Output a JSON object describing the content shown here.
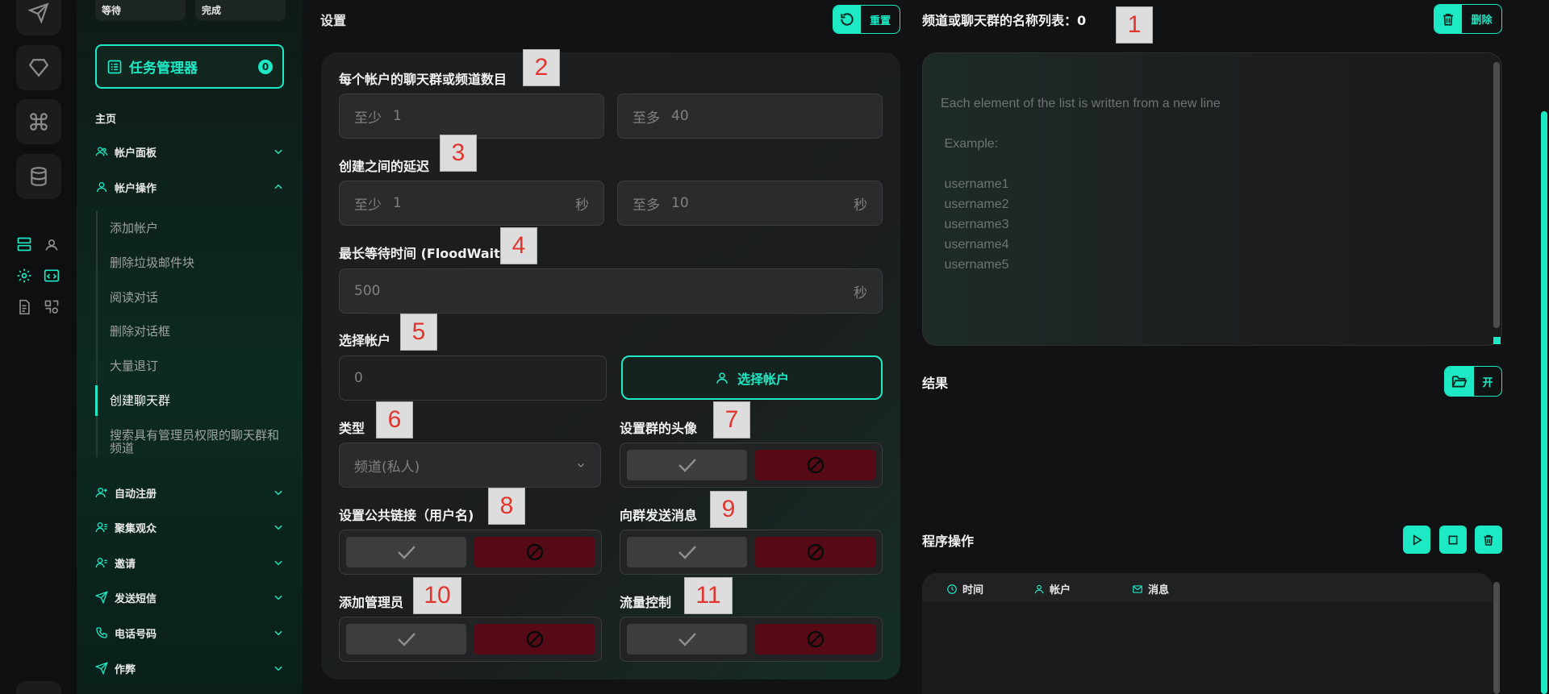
{
  "sidebar": {
    "status_tabs": [
      "等待",
      "完成"
    ],
    "task_manager": {
      "label": "任务管理器",
      "count": "0"
    },
    "section_title": "主页",
    "groups": [
      {
        "label": "帐户面板"
      },
      {
        "label": "帐户操作"
      }
    ],
    "sub_items": [
      "添加帐户",
      "删除垃圾邮件块",
      "阅读对话",
      "删除对话框",
      "大量退订",
      "创建聊天群",
      "搜索具有管理员权限的聊天群和频道"
    ],
    "active_sub_index": 5,
    "more_groups": [
      {
        "label": "自动注册"
      },
      {
        "label": "聚集观众"
      },
      {
        "label": "邀请"
      },
      {
        "label": "发送短信"
      },
      {
        "label": "电话号码"
      },
      {
        "label": "作弊"
      }
    ]
  },
  "settings": {
    "title": "设置",
    "reset_label": "重置",
    "chats_per_account": {
      "label": "每个帐户的聊天群或频道数目",
      "min_prefix": "至少",
      "min_value": "1",
      "max_prefix": "至多",
      "max_value": "40"
    },
    "delay": {
      "label": "创建之间的延迟",
      "min_prefix": "至少",
      "min_value": "1",
      "max_prefix": "至多",
      "max_value": "10",
      "unit": "秒"
    },
    "floodwait": {
      "label": "最长等待时间 (FloodWait)",
      "value": "500",
      "unit": "秒"
    },
    "accounts": {
      "label": "选择帐户",
      "value": "0",
      "button": "选择帐户"
    },
    "type": {
      "label": "类型",
      "value": "频道(私人)"
    },
    "avatar": {
      "label": "设置群的头像"
    },
    "public_link": {
      "label": "设置公共链接（用户名)"
    },
    "send_message": {
      "label": "向群发送消息"
    },
    "add_admin": {
      "label": "添加管理员"
    },
    "flow_control": {
      "label": "流量控制"
    }
  },
  "name_list": {
    "label": "频道或聊天群的名称列表：0",
    "delete_label": "删除",
    "placeholder_lines": [
      "Each element of the list is written from a new line",
      "",
      " Example:",
      "",
      " username1",
      " username2",
      " username3",
      " username4",
      " username5"
    ]
  },
  "result": {
    "label": "结果",
    "open_label": "开"
  },
  "operations": {
    "label": "程序操作",
    "columns": [
      "时间",
      "帐户",
      "消息"
    ]
  },
  "badges": [
    "1",
    "2",
    "3",
    "4",
    "5",
    "6",
    "7",
    "8",
    "9",
    "10",
    "11"
  ],
  "colors": {
    "accent": "#1de9c4",
    "danger": "#560a16",
    "badge_text": "#e2352d"
  }
}
